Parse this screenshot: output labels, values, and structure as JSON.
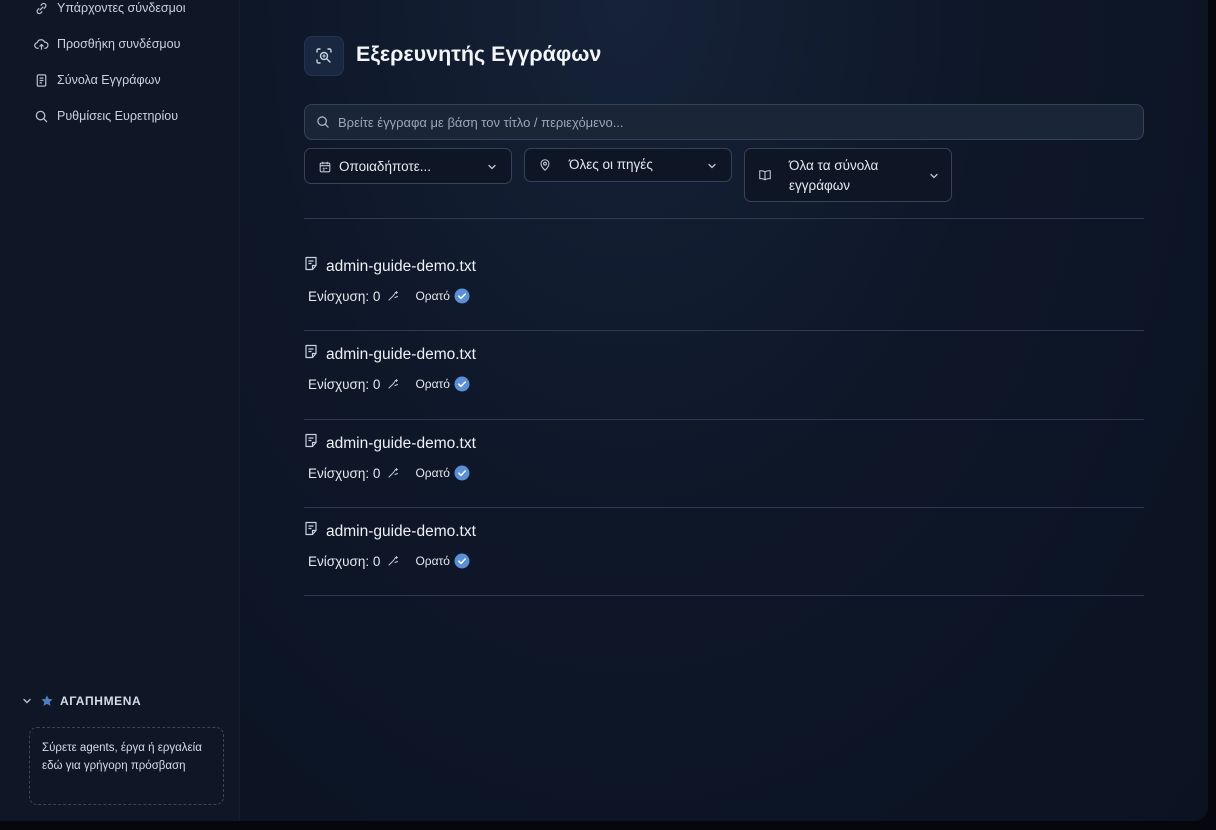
{
  "sidebar": {
    "items": [
      {
        "label": "Υπάρχοντες σύνδεσμοι",
        "icon": "link-icon"
      },
      {
        "label": "Προσθήκη συνδέσμου",
        "icon": "cloud-upload-icon"
      },
      {
        "label": "Σύνολα Εγγράφων",
        "icon": "documents-icon"
      },
      {
        "label": "Ρυθμίσεις Ευρετηρίου",
        "icon": "search-icon"
      }
    ],
    "favorites": {
      "title": "ΑΓΑΠΗΜΕΝΑ",
      "placeholder": "Σύρετε agents, έργα ή εργαλεία εδώ για γρήγορη πρόσβαση"
    }
  },
  "main": {
    "title": "Εξερευνητής Εγγράφων",
    "search_placeholder": "Βρείτε έγγραφα με βάση τον τίτλο / περιεχόμενο...",
    "filters": {
      "time": "Οποιαδήποτε...",
      "sources": "Όλες οι πηγές",
      "sets": "Όλα τα σύνολα εγγράφων"
    },
    "documents": [
      {
        "name": "admin-guide-demo.txt",
        "boost_label": "Ενίσχυση:",
        "boost": "0",
        "visibility": "Ορατό"
      },
      {
        "name": "admin-guide-demo.txt",
        "boost_label": "Ενίσχυση:",
        "boost": "0",
        "visibility": "Ορατό"
      },
      {
        "name": "admin-guide-demo.txt",
        "boost_label": "Ενίσχυση:",
        "boost": "0",
        "visibility": "Ορατό"
      },
      {
        "name": "admin-guide-demo.txt",
        "boost_label": "Ενίσχυση:",
        "boost": "0",
        "visibility": "Ορατό"
      }
    ]
  },
  "colors": {
    "accent": "#5b8fd6",
    "background": "#0c1423",
    "sidebar": "#0f1727"
  }
}
